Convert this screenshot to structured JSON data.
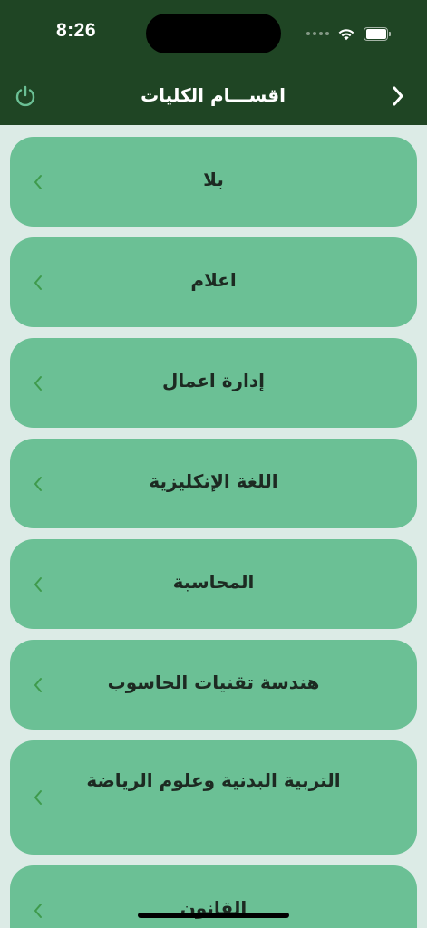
{
  "status_bar": {
    "time": "8:26"
  },
  "nav": {
    "title": "اقســـام الكليات",
    "power_icon": "power-icon",
    "back_icon": "chevron-right-icon"
  },
  "departments": [
    {
      "label": "بلا"
    },
    {
      "label": "اعلام"
    },
    {
      "label": "إدارة اعمال"
    },
    {
      "label": "اللغة الإنكليزية"
    },
    {
      "label": "المحاسبة"
    },
    {
      "label": "هندسة تقنيات الحاسوب"
    },
    {
      "label": "التربية البدنية وعلوم الرياضة"
    },
    {
      "label": "القانون"
    }
  ],
  "colors": {
    "header": "#1f4524",
    "background": "#dcebe6",
    "card": "#6bc095",
    "card_text": "#1d2a22",
    "chevron": "#3e9a4c",
    "power_icon": "#6bc095"
  }
}
